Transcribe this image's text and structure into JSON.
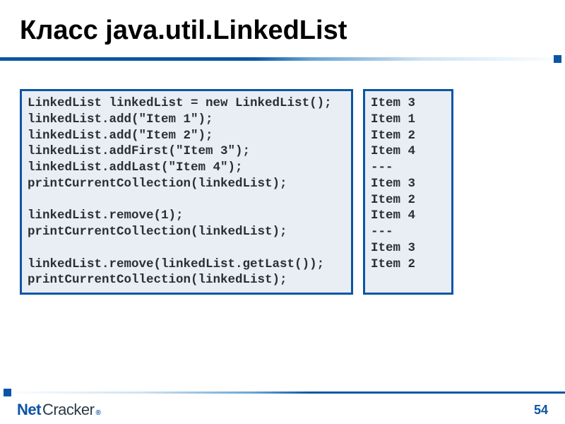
{
  "title": "Класс java.util.LinkedList",
  "code": "LinkedList linkedList = new LinkedList();\nlinkedList.add(\"Item 1\");\nlinkedList.add(\"Item 2\");\nlinkedList.addFirst(\"Item 3\");\nlinkedList.addLast(\"Item 4\");\nprintCurrentCollection(linkedList);\n\nlinkedList.remove(1);\nprintCurrentCollection(linkedList);\n\nlinkedList.remove(linkedList.getLast());\nprintCurrentCollection(linkedList);",
  "output": "Item 3\nItem 1\nItem 2\nItem 4\n---\nItem 3\nItem 2\nItem 4\n---\nItem 3\nItem 2",
  "brand": {
    "net": "Net",
    "cracker": "Cracker",
    "reg": "®"
  },
  "page_number": "54"
}
